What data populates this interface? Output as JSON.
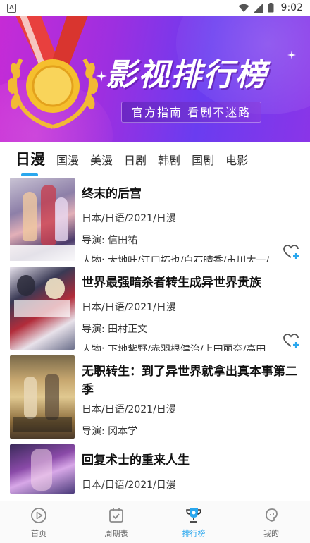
{
  "status_bar": {
    "time": "9:02",
    "app_badge": "A"
  },
  "banner": {
    "title": "影视排行榜",
    "subtitle": "官方指南 看剧不迷路"
  },
  "tabs": [
    {
      "label": "日漫",
      "active": true
    },
    {
      "label": "国漫"
    },
    {
      "label": "美漫"
    },
    {
      "label": "日剧"
    },
    {
      "label": "韩剧"
    },
    {
      "label": "国剧"
    },
    {
      "label": "电影"
    }
  ],
  "list": [
    {
      "title": "终末的后宫",
      "info": "日本/日语/2021/日漫",
      "director": "导演: 信田祐",
      "cast": "人物: 大地叶/江口拓也/白石晴香/市川太一/",
      "favorite_icon": "heart-plus-icon"
    },
    {
      "title": "世界最强暗杀者转生成异世界贵族",
      "info": "日本/日语/2021/日漫",
      "director": "导演: 田村正文",
      "cast": "人物: 下地紫野/赤羽根健治/上田丽奈/高田",
      "favorite_icon": "heart-plus-icon"
    },
    {
      "title": "无职转生：到了异世界就拿出真本事第二季",
      "info": "日本/日语/2021/日漫",
      "director": "导演: 冈本学"
    },
    {
      "title": "回复术士的重来人生",
      "info": "日本/日语/2021/日漫"
    }
  ],
  "bottom_nav": [
    {
      "label": "首页",
      "icon": "play-circle-icon"
    },
    {
      "label": "周期表",
      "icon": "calendar-check-icon"
    },
    {
      "label": "排行榜",
      "icon": "trophy-icon",
      "active": true
    },
    {
      "label": "我的",
      "icon": "profile-icon"
    }
  ],
  "colors": {
    "accent": "#2aa7ee",
    "banner_start": "#c62bd6",
    "banner_end": "#6a3cf0"
  }
}
